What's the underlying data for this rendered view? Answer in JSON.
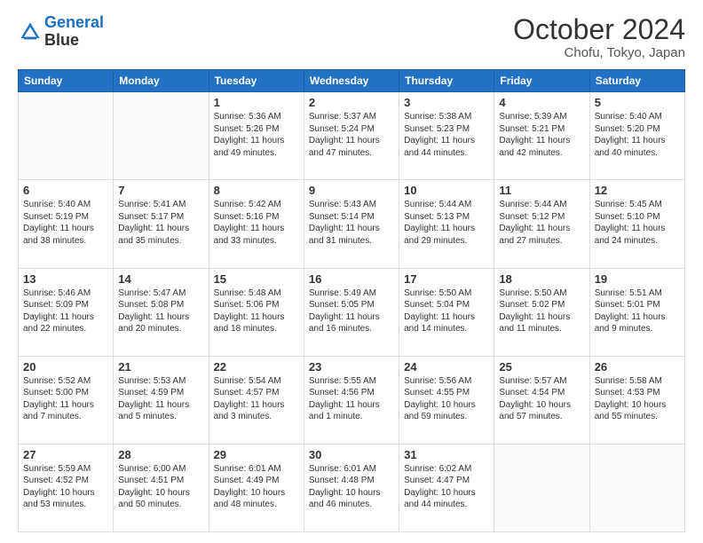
{
  "header": {
    "logo_line1": "General",
    "logo_line2": "Blue",
    "month": "October 2024",
    "location": "Chofu, Tokyo, Japan"
  },
  "weekdays": [
    "Sunday",
    "Monday",
    "Tuesday",
    "Wednesday",
    "Thursday",
    "Friday",
    "Saturday"
  ],
  "weeks": [
    [
      {
        "day": "",
        "empty": true
      },
      {
        "day": "",
        "empty": true
      },
      {
        "day": "1",
        "sunrise": "Sunrise: 5:36 AM",
        "sunset": "Sunset: 5:26 PM",
        "daylight": "Daylight: 11 hours and 49 minutes."
      },
      {
        "day": "2",
        "sunrise": "Sunrise: 5:37 AM",
        "sunset": "Sunset: 5:24 PM",
        "daylight": "Daylight: 11 hours and 47 minutes."
      },
      {
        "day": "3",
        "sunrise": "Sunrise: 5:38 AM",
        "sunset": "Sunset: 5:23 PM",
        "daylight": "Daylight: 11 hours and 44 minutes."
      },
      {
        "day": "4",
        "sunrise": "Sunrise: 5:39 AM",
        "sunset": "Sunset: 5:21 PM",
        "daylight": "Daylight: 11 hours and 42 minutes."
      },
      {
        "day": "5",
        "sunrise": "Sunrise: 5:40 AM",
        "sunset": "Sunset: 5:20 PM",
        "daylight": "Daylight: 11 hours and 40 minutes."
      }
    ],
    [
      {
        "day": "6",
        "sunrise": "Sunrise: 5:40 AM",
        "sunset": "Sunset: 5:19 PM",
        "daylight": "Daylight: 11 hours and 38 minutes."
      },
      {
        "day": "7",
        "sunrise": "Sunrise: 5:41 AM",
        "sunset": "Sunset: 5:17 PM",
        "daylight": "Daylight: 11 hours and 35 minutes."
      },
      {
        "day": "8",
        "sunrise": "Sunrise: 5:42 AM",
        "sunset": "Sunset: 5:16 PM",
        "daylight": "Daylight: 11 hours and 33 minutes."
      },
      {
        "day": "9",
        "sunrise": "Sunrise: 5:43 AM",
        "sunset": "Sunset: 5:14 PM",
        "daylight": "Daylight: 11 hours and 31 minutes."
      },
      {
        "day": "10",
        "sunrise": "Sunrise: 5:44 AM",
        "sunset": "Sunset: 5:13 PM",
        "daylight": "Daylight: 11 hours and 29 minutes."
      },
      {
        "day": "11",
        "sunrise": "Sunrise: 5:44 AM",
        "sunset": "Sunset: 5:12 PM",
        "daylight": "Daylight: 11 hours and 27 minutes."
      },
      {
        "day": "12",
        "sunrise": "Sunrise: 5:45 AM",
        "sunset": "Sunset: 5:10 PM",
        "daylight": "Daylight: 11 hours and 24 minutes."
      }
    ],
    [
      {
        "day": "13",
        "sunrise": "Sunrise: 5:46 AM",
        "sunset": "Sunset: 5:09 PM",
        "daylight": "Daylight: 11 hours and 22 minutes."
      },
      {
        "day": "14",
        "sunrise": "Sunrise: 5:47 AM",
        "sunset": "Sunset: 5:08 PM",
        "daylight": "Daylight: 11 hours and 20 minutes."
      },
      {
        "day": "15",
        "sunrise": "Sunrise: 5:48 AM",
        "sunset": "Sunset: 5:06 PM",
        "daylight": "Daylight: 11 hours and 18 minutes."
      },
      {
        "day": "16",
        "sunrise": "Sunrise: 5:49 AM",
        "sunset": "Sunset: 5:05 PM",
        "daylight": "Daylight: 11 hours and 16 minutes."
      },
      {
        "day": "17",
        "sunrise": "Sunrise: 5:50 AM",
        "sunset": "Sunset: 5:04 PM",
        "daylight": "Daylight: 11 hours and 14 minutes."
      },
      {
        "day": "18",
        "sunrise": "Sunrise: 5:50 AM",
        "sunset": "Sunset: 5:02 PM",
        "daylight": "Daylight: 11 hours and 11 minutes."
      },
      {
        "day": "19",
        "sunrise": "Sunrise: 5:51 AM",
        "sunset": "Sunset: 5:01 PM",
        "daylight": "Daylight: 11 hours and 9 minutes."
      }
    ],
    [
      {
        "day": "20",
        "sunrise": "Sunrise: 5:52 AM",
        "sunset": "Sunset: 5:00 PM",
        "daylight": "Daylight: 11 hours and 7 minutes."
      },
      {
        "day": "21",
        "sunrise": "Sunrise: 5:53 AM",
        "sunset": "Sunset: 4:59 PM",
        "daylight": "Daylight: 11 hours and 5 minutes."
      },
      {
        "day": "22",
        "sunrise": "Sunrise: 5:54 AM",
        "sunset": "Sunset: 4:57 PM",
        "daylight": "Daylight: 11 hours and 3 minutes."
      },
      {
        "day": "23",
        "sunrise": "Sunrise: 5:55 AM",
        "sunset": "Sunset: 4:56 PM",
        "daylight": "Daylight: 11 hours and 1 minute."
      },
      {
        "day": "24",
        "sunrise": "Sunrise: 5:56 AM",
        "sunset": "Sunset: 4:55 PM",
        "daylight": "Daylight: 10 hours and 59 minutes."
      },
      {
        "day": "25",
        "sunrise": "Sunrise: 5:57 AM",
        "sunset": "Sunset: 4:54 PM",
        "daylight": "Daylight: 10 hours and 57 minutes."
      },
      {
        "day": "26",
        "sunrise": "Sunrise: 5:58 AM",
        "sunset": "Sunset: 4:53 PM",
        "daylight": "Daylight: 10 hours and 55 minutes."
      }
    ],
    [
      {
        "day": "27",
        "sunrise": "Sunrise: 5:59 AM",
        "sunset": "Sunset: 4:52 PM",
        "daylight": "Daylight: 10 hours and 53 minutes."
      },
      {
        "day": "28",
        "sunrise": "Sunrise: 6:00 AM",
        "sunset": "Sunset: 4:51 PM",
        "daylight": "Daylight: 10 hours and 50 minutes."
      },
      {
        "day": "29",
        "sunrise": "Sunrise: 6:01 AM",
        "sunset": "Sunset: 4:49 PM",
        "daylight": "Daylight: 10 hours and 48 minutes."
      },
      {
        "day": "30",
        "sunrise": "Sunrise: 6:01 AM",
        "sunset": "Sunset: 4:48 PM",
        "daylight": "Daylight: 10 hours and 46 minutes."
      },
      {
        "day": "31",
        "sunrise": "Sunrise: 6:02 AM",
        "sunset": "Sunset: 4:47 PM",
        "daylight": "Daylight: 10 hours and 44 minutes."
      },
      {
        "day": "",
        "empty": true
      },
      {
        "day": "",
        "empty": true
      }
    ]
  ]
}
